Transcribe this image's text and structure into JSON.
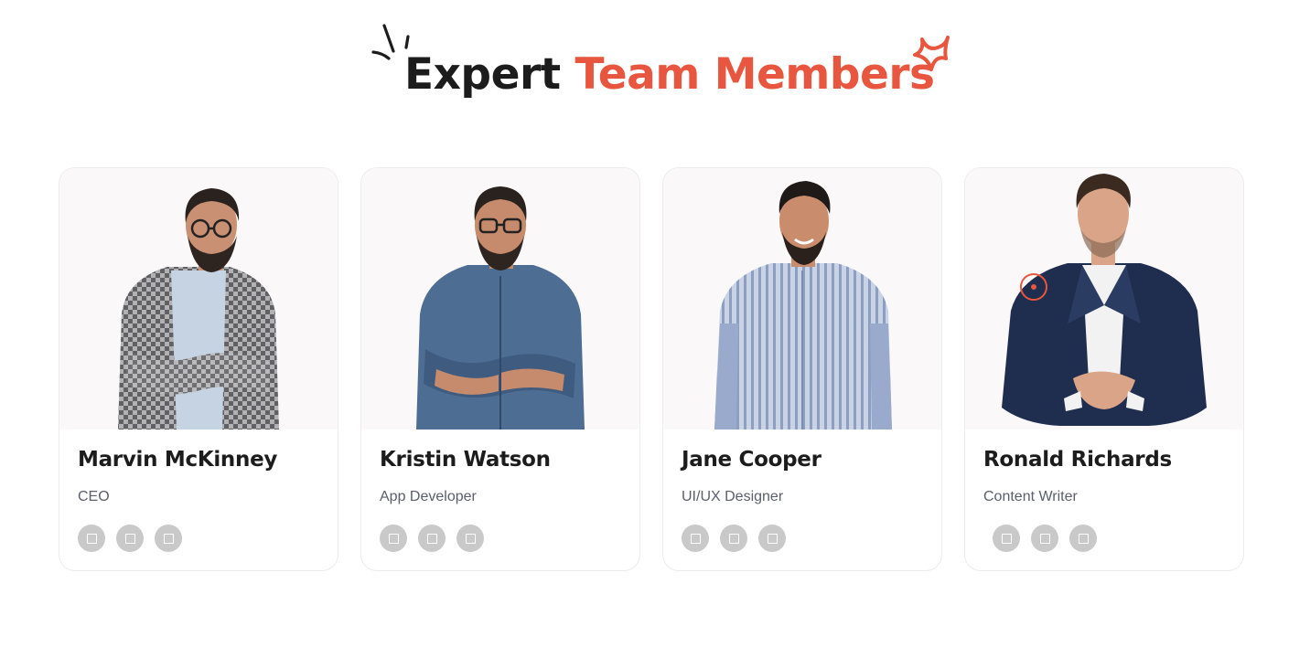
{
  "heading": {
    "prefix": "Expert",
    "accent": "Team Members"
  },
  "colors": {
    "accent": "#e8563f",
    "text": "#1c1c1c",
    "muted": "#5a5f6b",
    "social_bg": "#c9c9c9"
  },
  "members": [
    {
      "name": "Marvin McKinney",
      "role": "CEO",
      "social_icons": [
        "social-icon",
        "social-icon",
        "social-icon"
      ]
    },
    {
      "name": "Kristin Watson",
      "role": "App Developer",
      "social_icons": [
        "social-icon",
        "social-icon",
        "social-icon"
      ]
    },
    {
      "name": "Jane Cooper",
      "role": "UI/UX Designer",
      "social_icons": [
        "social-icon",
        "social-icon",
        "social-icon"
      ]
    },
    {
      "name": "Ronald Richards",
      "role": "Content Writer",
      "social_icons": [
        "social-icon",
        "social-icon",
        "social-icon"
      ]
    }
  ]
}
